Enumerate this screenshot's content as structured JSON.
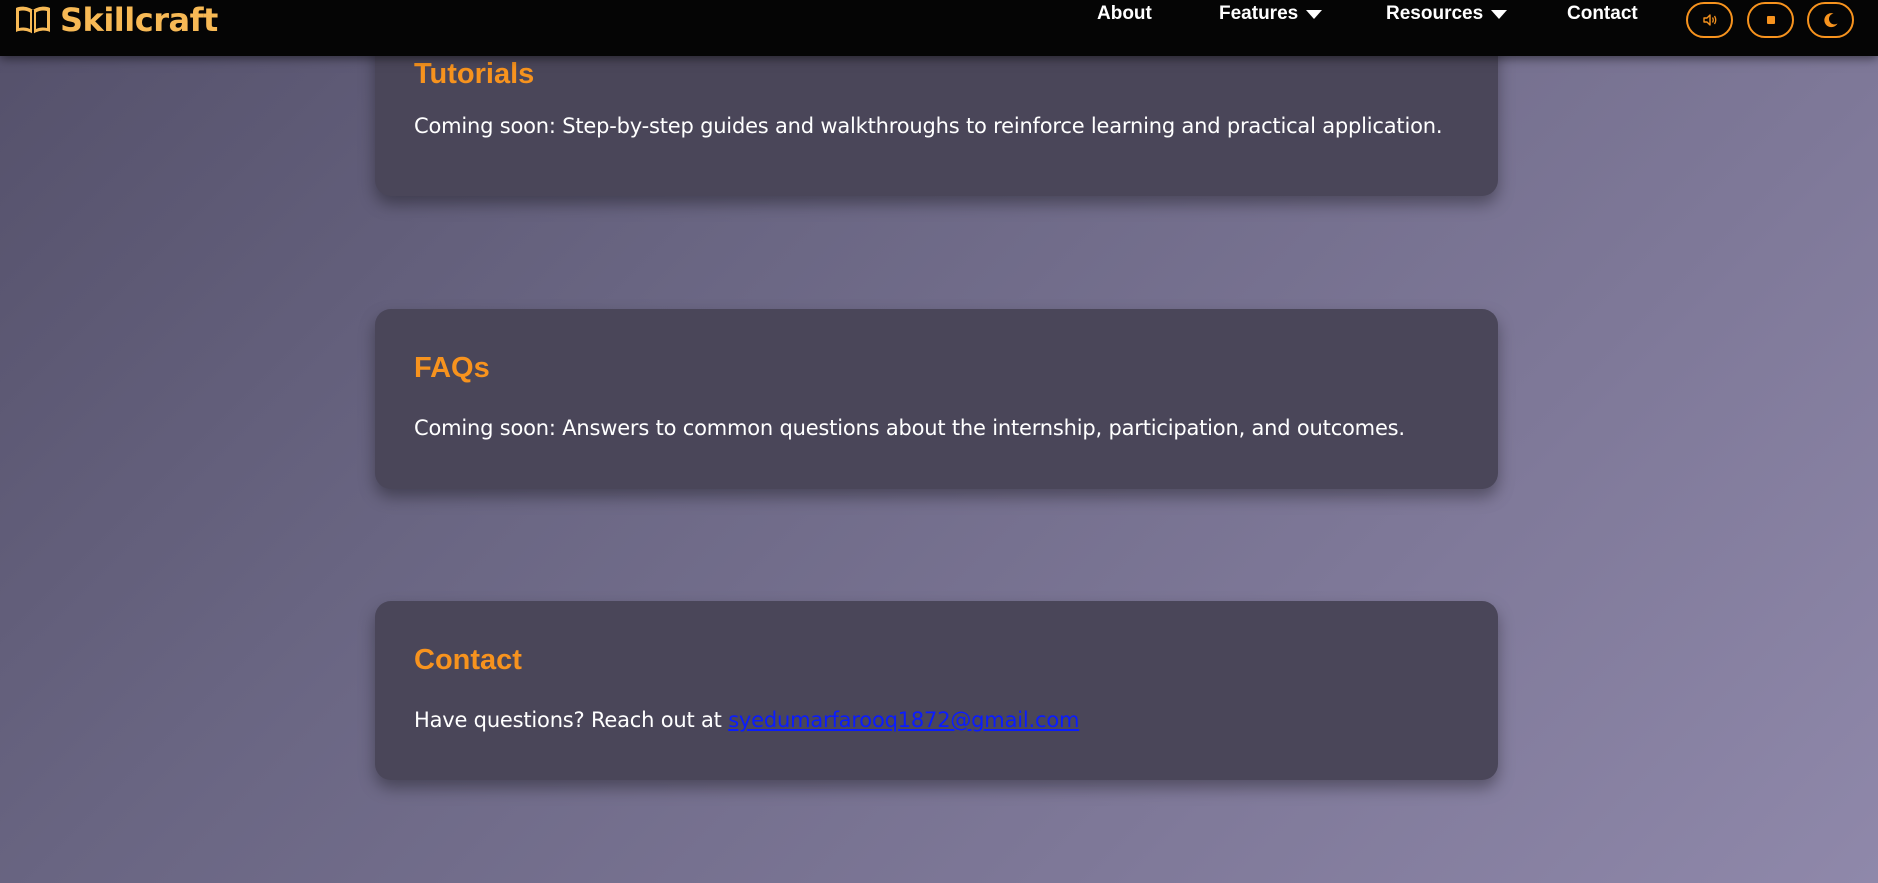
{
  "header": {
    "brand": "Skillcraft",
    "nav": {
      "about": "About",
      "features": "Features",
      "resources": "Resources",
      "contact": "Contact"
    },
    "buttons": [
      "speaker-icon",
      "stop-icon",
      "moon-icon"
    ]
  },
  "sections": {
    "tutorials": {
      "title": "Tutorials",
      "text": "Coming soon: Step-by-step guides and walkthroughs to reinforce learning and practical application."
    },
    "faqs": {
      "title": "FAQs",
      "text": "Coming soon: Answers to common questions about the internship, participation, and outcomes."
    },
    "contact": {
      "title": "Contact",
      "text_prefix": "Have questions? Reach out at ",
      "email": "syedumarfarooq1872@gmail.com"
    }
  },
  "colors": {
    "accent": "#f7931e",
    "brand": "#f7b955",
    "link": "#0a1cff",
    "navbar": "#050505",
    "card": "#4a4659"
  }
}
